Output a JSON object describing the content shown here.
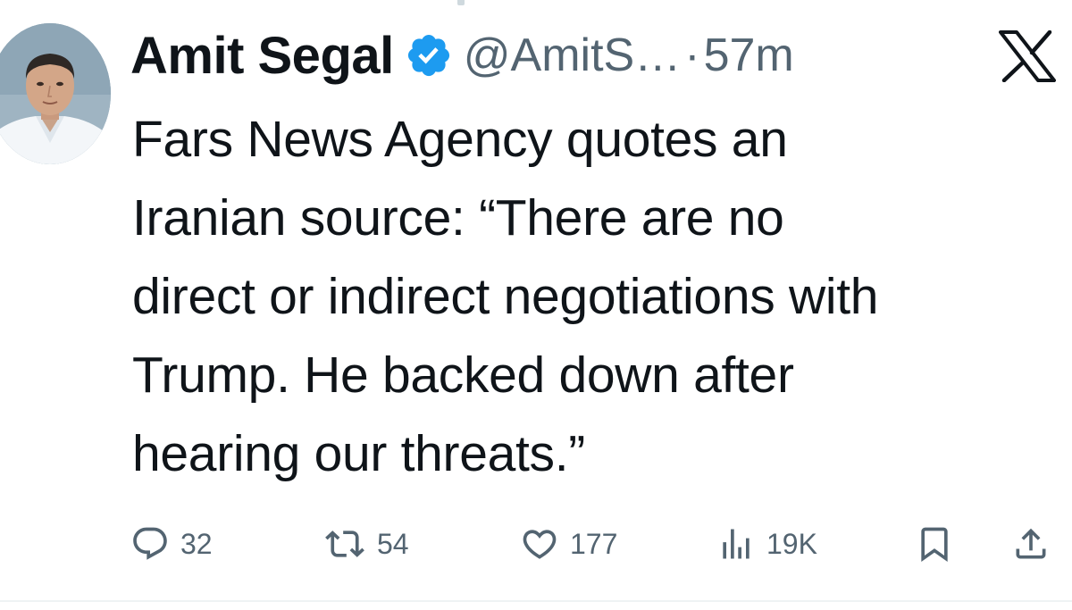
{
  "tweet": {
    "author": {
      "display_name": "Amit Segal",
      "handle": "@AmitS…",
      "verified": true,
      "verified_color": "#1d9bf0"
    },
    "separator": "·",
    "timestamp": "57m",
    "source_logo": "x-logo-icon",
    "text_lines": [
      "Fars News Agency quotes an",
      "Iranian source: “There are no",
      "direct or indirect negotiations with",
      "Trump. He backed down after",
      "hearing our threats.”"
    ],
    "actions": {
      "replies": {
        "icon": "reply-icon",
        "count": "32"
      },
      "reposts": {
        "icon": "repost-icon",
        "count": "54"
      },
      "likes": {
        "icon": "heart-icon",
        "count": "177"
      },
      "views": {
        "icon": "views-icon",
        "count": "19K"
      },
      "bookmark": {
        "icon": "bookmark-icon"
      },
      "share": {
        "icon": "share-icon"
      }
    }
  },
  "colors": {
    "text_primary": "#0f1419",
    "text_secondary": "#536471",
    "verified_blue": "#1d9bf0",
    "divider": "#eff3f4"
  }
}
